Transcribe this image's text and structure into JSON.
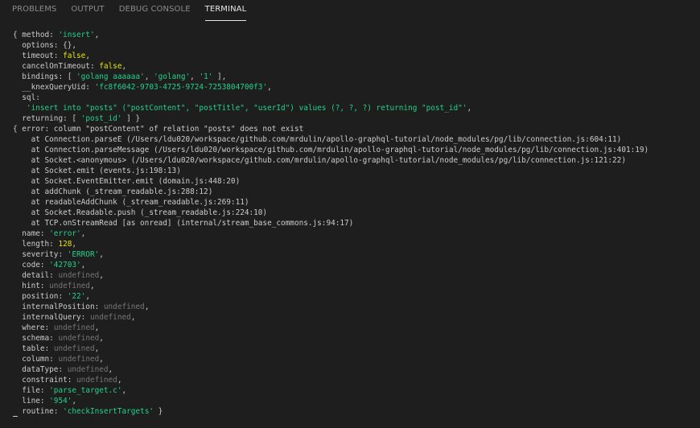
{
  "tabs": [
    {
      "label": "PROBLEMS",
      "active": false
    },
    {
      "label": "OUTPUT",
      "active": false
    },
    {
      "label": "DEBUG CONSOLE",
      "active": false
    },
    {
      "label": "TERMINAL",
      "active": true
    }
  ],
  "colors": {
    "background": "#1e1e1e",
    "text": "#cccccc",
    "string": "#23d18b",
    "number": "#e5e510",
    "undefined": "#767676",
    "tab_inactive": "#8b8b8b",
    "tab_active": "#e7e7e7"
  },
  "terminal_lines": [
    [
      {
        "t": "{ method: "
      },
      {
        "t": "'insert'",
        "c": "s"
      },
      {
        "t": ","
      }
    ],
    [
      {
        "t": "  options: {},"
      }
    ],
    [
      {
        "t": "  timeout: "
      },
      {
        "t": "false",
        "c": "n"
      },
      {
        "t": ","
      }
    ],
    [
      {
        "t": "  cancelOnTimeout: "
      },
      {
        "t": "false",
        "c": "n"
      },
      {
        "t": ","
      }
    ],
    [
      {
        "t": "  bindings: [ "
      },
      {
        "t": "'golang aaaaaa'",
        "c": "s"
      },
      {
        "t": ", "
      },
      {
        "t": "'golang'",
        "c": "s"
      },
      {
        "t": ", "
      },
      {
        "t": "'1'",
        "c": "s"
      },
      {
        "t": " ],"
      }
    ],
    [
      {
        "t": "  __knexQueryUid: "
      },
      {
        "t": "'fc8f6042-9703-4725-9724-7253804700f3'",
        "c": "s"
      },
      {
        "t": ","
      }
    ],
    [
      {
        "t": "  sql:"
      }
    ],
    [
      {
        "t": "   "
      },
      {
        "t": "'insert into \"posts\" (\"postContent\", \"postTitle\", \"userId\") values (?, ?, ?) returning \"post_id\"'",
        "c": "s"
      },
      {
        "t": ","
      }
    ],
    [
      {
        "t": "  returning: [ "
      },
      {
        "t": "'post_id'",
        "c": "s"
      },
      {
        "t": " ] }"
      }
    ],
    [
      {
        "t": "{ error: column \"postContent\" of relation \"posts\" does not exist"
      }
    ],
    [
      {
        "t": "    at Connection.parseE (/Users/ldu020/workspace/github.com/mrdulin/apollo-graphql-tutorial/node_modules/pg/lib/connection.js:604:11)"
      }
    ],
    [
      {
        "t": "    at Connection.parseMessage (/Users/ldu020/workspace/github.com/mrdulin/apollo-graphql-tutorial/node_modules/pg/lib/connection.js:401:19)"
      }
    ],
    [
      {
        "t": "    at Socket.<anonymous> (/Users/ldu020/workspace/github.com/mrdulin/apollo-graphql-tutorial/node_modules/pg/lib/connection.js:121:22)"
      }
    ],
    [
      {
        "t": "    at Socket.emit (events.js:198:13)"
      }
    ],
    [
      {
        "t": "    at Socket.EventEmitter.emit (domain.js:448:20)"
      }
    ],
    [
      {
        "t": "    at addChunk (_stream_readable.js:288:12)"
      }
    ],
    [
      {
        "t": "    at readableAddChunk (_stream_readable.js:269:11)"
      }
    ],
    [
      {
        "t": "    at Socket.Readable.push (_stream_readable.js:224:10)"
      }
    ],
    [
      {
        "t": "    at TCP.onStreamRead [as onread] (internal/stream_base_commons.js:94:17)"
      }
    ],
    [
      {
        "t": "  name: "
      },
      {
        "t": "'error'",
        "c": "s"
      },
      {
        "t": ","
      }
    ],
    [
      {
        "t": "  length: "
      },
      {
        "t": "128",
        "c": "n"
      },
      {
        "t": ","
      }
    ],
    [
      {
        "t": "  severity: "
      },
      {
        "t": "'ERROR'",
        "c": "s"
      },
      {
        "t": ","
      }
    ],
    [
      {
        "t": "  code: "
      },
      {
        "t": "'42703'",
        "c": "s"
      },
      {
        "t": ","
      }
    ],
    [
      {
        "t": "  detail: "
      },
      {
        "t": "undefined",
        "c": "u"
      },
      {
        "t": ","
      }
    ],
    [
      {
        "t": "  hint: "
      },
      {
        "t": "undefined",
        "c": "u"
      },
      {
        "t": ","
      }
    ],
    [
      {
        "t": "  position: "
      },
      {
        "t": "'22'",
        "c": "s"
      },
      {
        "t": ","
      }
    ],
    [
      {
        "t": "  internalPosition: "
      },
      {
        "t": "undefined",
        "c": "u"
      },
      {
        "t": ","
      }
    ],
    [
      {
        "t": "  internalQuery: "
      },
      {
        "t": "undefined",
        "c": "u"
      },
      {
        "t": ","
      }
    ],
    [
      {
        "t": "  where: "
      },
      {
        "t": "undefined",
        "c": "u"
      },
      {
        "t": ","
      }
    ],
    [
      {
        "t": "  schema: "
      },
      {
        "t": "undefined",
        "c": "u"
      },
      {
        "t": ","
      }
    ],
    [
      {
        "t": "  table: "
      },
      {
        "t": "undefined",
        "c": "u"
      },
      {
        "t": ","
      }
    ],
    [
      {
        "t": "  column: "
      },
      {
        "t": "undefined",
        "c": "u"
      },
      {
        "t": ","
      }
    ],
    [
      {
        "t": "  dataType: "
      },
      {
        "t": "undefined",
        "c": "u"
      },
      {
        "t": ","
      }
    ],
    [
      {
        "t": "  constraint: "
      },
      {
        "t": "undefined",
        "c": "u"
      },
      {
        "t": ","
      }
    ],
    [
      {
        "t": "  file: "
      },
      {
        "t": "'parse_target.c'",
        "c": "s"
      },
      {
        "t": ","
      }
    ],
    [
      {
        "t": "  line: "
      },
      {
        "t": "'954'",
        "c": "s"
      },
      {
        "t": ","
      }
    ],
    [
      {
        "t": "  routine: "
      },
      {
        "t": "'checkInsertTargets'",
        "c": "s"
      },
      {
        "t": " }"
      }
    ]
  ]
}
